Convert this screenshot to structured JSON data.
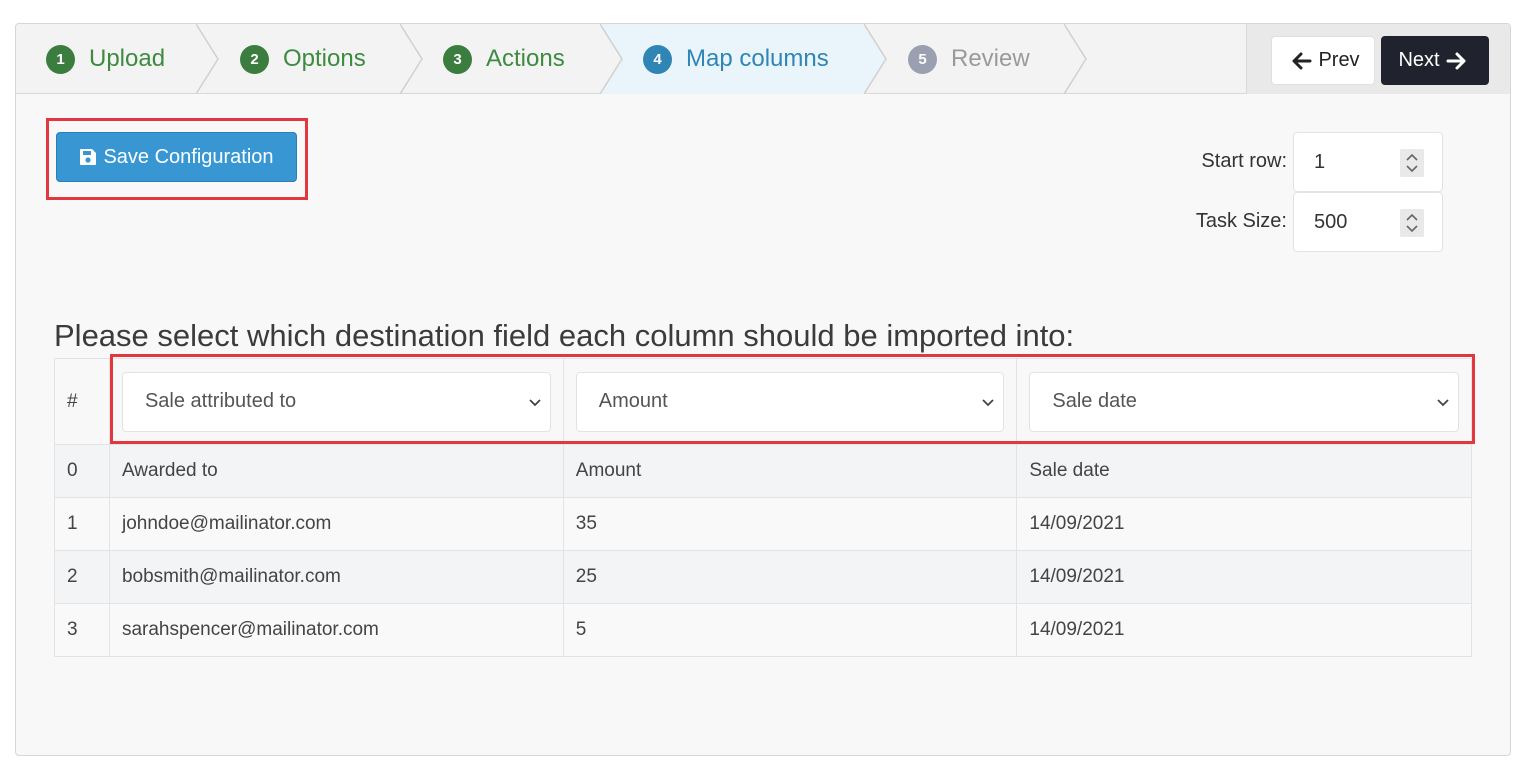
{
  "wizard": {
    "steps": [
      {
        "num": "1",
        "label": "Upload",
        "state": "done"
      },
      {
        "num": "2",
        "label": "Options",
        "state": "done"
      },
      {
        "num": "3",
        "label": "Actions",
        "state": "done"
      },
      {
        "num": "4",
        "label": "Map columns",
        "state": "active"
      },
      {
        "num": "5",
        "label": "Review",
        "state": "todo"
      }
    ],
    "prev_label": "Prev",
    "next_label": "Next"
  },
  "config": {
    "save_label": "Save Configuration",
    "start_row_label": "Start row:",
    "start_row_value": "1",
    "task_size_label": "Task Size:",
    "task_size_value": "500"
  },
  "mapping": {
    "instruction": "Please select which destination field each column should be imported into:",
    "hash_header": "#",
    "selects": [
      "Sale attributed to",
      "Amount",
      "Sale date"
    ],
    "rows": [
      {
        "index": "0",
        "cells": [
          "Awarded to",
          "Amount",
          "Sale date"
        ]
      },
      {
        "index": "1",
        "cells": [
          "johndoe@mailinator.com",
          "35",
          "14/09/2021"
        ]
      },
      {
        "index": "2",
        "cells": [
          "bobsmith@mailinator.com",
          "25",
          "14/09/2021"
        ]
      },
      {
        "index": "3",
        "cells": [
          "sarahspencer@mailinator.com",
          "5",
          "14/09/2021"
        ]
      }
    ]
  },
  "colors": {
    "done": "#3a7d3e",
    "active": "#2f86b4",
    "todo": "#9aa0b0",
    "primary_button": "#3897d3",
    "next_button": "#20232e",
    "highlight": "#e0383e"
  }
}
